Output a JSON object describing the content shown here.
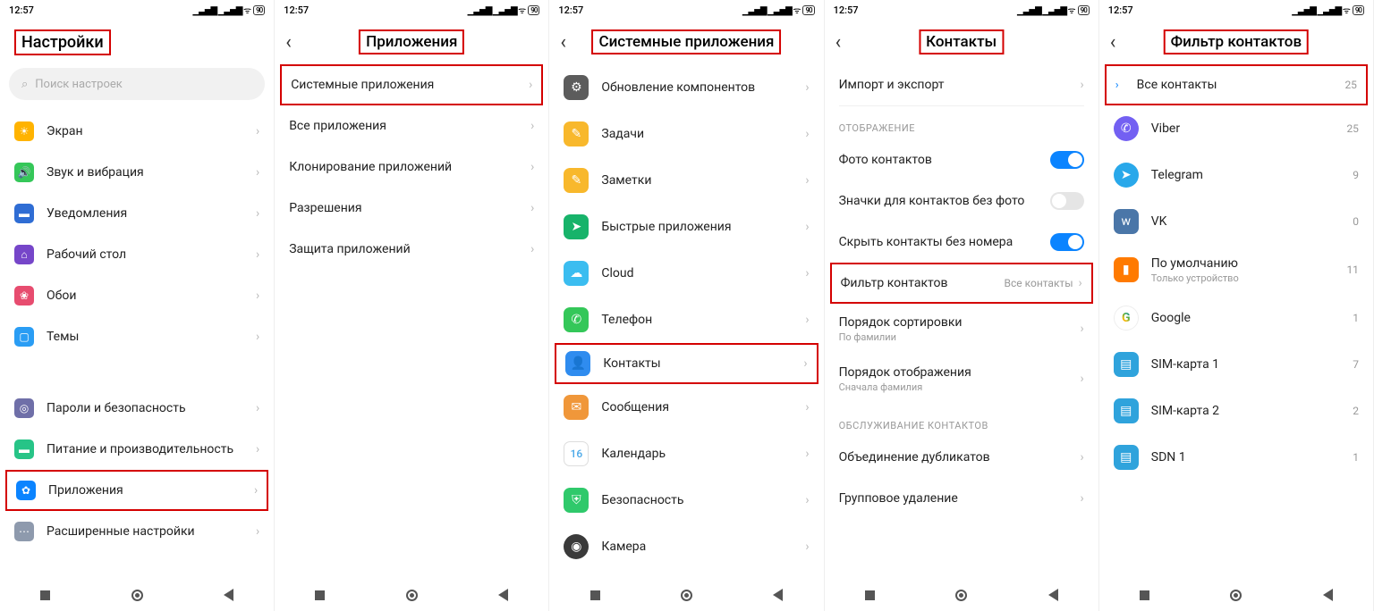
{
  "time": "12:57",
  "battery": "90",
  "s1": {
    "title": "Настройки",
    "search_ph": "Поиск настроек",
    "items": [
      {
        "label": "Экран",
        "bg": "#ffb300",
        "glyph": "☀"
      },
      {
        "label": "Звук и вибрация",
        "bg": "#35c759",
        "glyph": "🔊"
      },
      {
        "label": "Уведомления",
        "bg": "#2f6dd4",
        "glyph": "▬"
      },
      {
        "label": "Рабочий стол",
        "bg": "#7646c9",
        "glyph": "⌂"
      },
      {
        "label": "Обои",
        "bg": "#e74c6f",
        "glyph": "❀"
      },
      {
        "label": "Темы",
        "bg": "#2a9df4",
        "glyph": "▢"
      }
    ],
    "items2": [
      {
        "label": "Пароли и безопасность",
        "bg": "#6f6fa8",
        "glyph": "◎"
      },
      {
        "label": "Питание и производительность",
        "bg": "#27c487",
        "glyph": "▬"
      },
      {
        "label": "Приложения",
        "bg": "#0b84ff",
        "glyph": "✿",
        "hl": true
      },
      {
        "label": "Расширенные настройки",
        "bg": "#8e9aad",
        "glyph": "⋯"
      }
    ]
  },
  "s2": {
    "title": "Приложения",
    "items": [
      {
        "label": "Системные приложения",
        "hl": true
      },
      {
        "label": "Все приложения"
      },
      {
        "label": "Клонирование приложений"
      },
      {
        "label": "Разрешения"
      },
      {
        "label": "Защита приложений"
      }
    ]
  },
  "s3": {
    "title": "Системные приложения",
    "items": [
      {
        "label": "Обновление компонентов",
        "bg": "#5c5c5c",
        "glyph": "⚙"
      },
      {
        "label": "Задачи",
        "bg": "#f8b82c",
        "glyph": "✎"
      },
      {
        "label": "Заметки",
        "bg": "#f8b82c",
        "glyph": "✎"
      },
      {
        "label": "Быстрые приложения",
        "bg": "#17b36a",
        "glyph": "➤"
      },
      {
        "label": "Cloud",
        "bg": "#3bbdf0",
        "glyph": "☁"
      },
      {
        "label": "Телефон",
        "bg": "#34c759",
        "glyph": "✆"
      },
      {
        "label": "Контакты",
        "bg": "#2f8cef",
        "glyph": "👤",
        "hl": true
      },
      {
        "label": "Сообщения",
        "bg": "#f0973a",
        "glyph": "✉"
      },
      {
        "label": "Календарь",
        "bg": "#fff",
        "glyph": "16",
        "cal": true
      },
      {
        "label": "Безопасность",
        "bg": "#2fc96b",
        "glyph": "⛨"
      },
      {
        "label": "Камера",
        "bg": "#3a3a3a",
        "glyph": "◉",
        "round": true
      }
    ]
  },
  "s4": {
    "title": "Контакты",
    "top": {
      "label": "Импорт и экспорт"
    },
    "sec1": "ОТОБРАЖЕНИЕ",
    "display": [
      {
        "label": "Фото контактов",
        "toggle": "on"
      },
      {
        "label": "Значки для контактов без фото",
        "toggle": "off"
      },
      {
        "label": "Скрыть контакты без номера",
        "toggle": "on"
      },
      {
        "label": "Фильтр контактов",
        "val": "Все контакты",
        "hl": true
      },
      {
        "label": "Порядок сортировки",
        "sub": "По фамилии"
      },
      {
        "label": "Порядок отображения",
        "sub": "Сначала фамилия"
      }
    ],
    "sec2": "ОБСЛУЖИВАНИЕ КОНТАКТОВ",
    "maint": [
      {
        "label": "Объединение дубликатов"
      },
      {
        "label": "Групповое удаление"
      }
    ]
  },
  "s5": {
    "title": "Фильтр контактов",
    "items": [
      {
        "label": "Все контакты",
        "count": "25",
        "hl": true,
        "lead": true
      },
      {
        "label": "Viber",
        "count": "25",
        "bg": "#7360f2",
        "glyph": "✆",
        "round": true
      },
      {
        "label": "Telegram",
        "count": "9",
        "bg": "#29a8ea",
        "glyph": "➤",
        "round": true
      },
      {
        "label": "VK",
        "count": "0",
        "bg": "#4a76a8",
        "glyph": "w"
      },
      {
        "label": "По умолчанию",
        "sub": "Только устройство",
        "count": "11",
        "bg": "#ff7a00",
        "glyph": "▮"
      },
      {
        "label": "Google",
        "count": "1",
        "bg": "#fff",
        "glyph": "G",
        "round": true,
        "g": true
      },
      {
        "label": "SIM-карта 1",
        "count": "7",
        "bg": "#2fa3dc",
        "glyph": "▤"
      },
      {
        "label": "SIM-карта 2",
        "count": "2",
        "bg": "#2fa3dc",
        "glyph": "▤"
      },
      {
        "label": "SDN 1",
        "count": "1",
        "bg": "#2fa3dc",
        "glyph": "▤"
      }
    ]
  }
}
